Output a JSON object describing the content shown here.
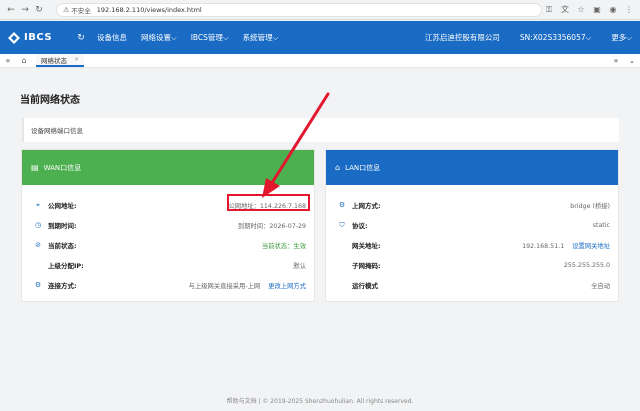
{
  "browser": {
    "insecure_label": "不安全",
    "url": "192.168.2.110/views/index.html"
  },
  "app": {
    "logo_text": "IBCS",
    "menu": [
      {
        "label": "设备信息"
      },
      {
        "label": "网络设置⌵"
      },
      {
        "label": "IBCS管理⌵"
      },
      {
        "label": "系统管理⌵"
      }
    ],
    "company": "江苏启迪控股有限公司",
    "serial": "SN:X02S3356057⌵",
    "more": "更多⌵",
    "accent": "#1a6bc4"
  },
  "tabs": [
    {
      "label": "网络状态",
      "close": "×"
    }
  ],
  "page": {
    "title": "当前网络状态",
    "section_title": "设备网络端口信息"
  },
  "wan": {
    "title": "WAN口信息",
    "color": "#4caf50",
    "rows": [
      {
        "icon": "location-icon",
        "label": "公网地址:",
        "value": "公网地址：114.226.7.168"
      },
      {
        "icon": "clock-icon",
        "label": "到期时间:",
        "value": "到期时间：2026-07-29"
      },
      {
        "icon": "check-circle-icon",
        "label": "当前状态:",
        "value": "当前状态：生效"
      },
      {
        "icon": "",
        "label": "上级分配IP:",
        "value": "默认"
      },
      {
        "icon": "gear-icon",
        "label": "连接方式:",
        "value": "与上级网关直接采用-上网",
        "link": "更改上网方式"
      }
    ]
  },
  "lan": {
    "title": "LAN口信息",
    "color": "#1a6bc4",
    "rows": [
      {
        "icon": "gear-icon",
        "label": "上网方式:",
        "value": "bridge (桥接)"
      },
      {
        "icon": "shield-icon",
        "label": "协议:",
        "value": "static"
      },
      {
        "icon": "",
        "label": "网关地址:",
        "value": "192.168.51.1",
        "link": "设置网关地址"
      },
      {
        "icon": "",
        "label": "子网掩码:",
        "value": "255.255.255.0"
      },
      {
        "icon": "",
        "label": "运行模式",
        "value": "全自动"
      }
    ]
  },
  "footer": {
    "text": "帮助与文档 |  © 2019-2025 Shenzhuohulian. All rights reserved."
  },
  "annotation_color": "#e3172e"
}
